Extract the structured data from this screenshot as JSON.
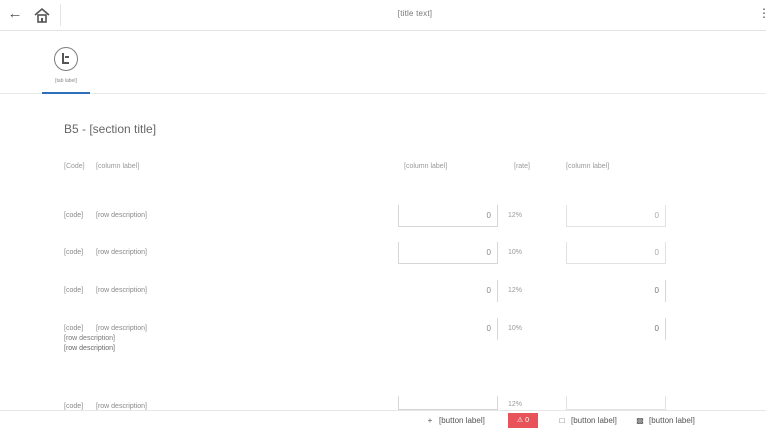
{
  "topbar": {
    "back_icon": "arrow-left-icon",
    "home_icon": "home-icon",
    "title": "[title text]",
    "more_icon": "more-vertical-icon"
  },
  "tab": {
    "label": "[tab label]",
    "icon": "document-icon"
  },
  "section": {
    "title": "B5 - [section title]"
  },
  "table": {
    "headers": {
      "code": "[Code]",
      "description": "[column label]",
      "amount": "[column label]",
      "rate": "[rate]",
      "result": "[column label]"
    },
    "rows": [
      {
        "code": "[code]",
        "description": "[row description]",
        "amount": "0",
        "rate": "12%",
        "result": "0"
      },
      {
        "code": "[code]",
        "description": "[row description]",
        "amount": "0",
        "rate": "10%",
        "result": "0"
      },
      {
        "code": "[code]",
        "description": "[row description]",
        "amount": "0",
        "rate": "12%",
        "result": "0"
      },
      {
        "code": "[code]",
        "description": "[row description]",
        "description_extra": "[row description]",
        "description_last": "[row description]",
        "amount": "0",
        "rate": "10%",
        "result": "0"
      },
      {
        "code": "[code]",
        "description": "[row description]",
        "amount": "",
        "rate": "12%",
        "result": ""
      }
    ]
  },
  "footer": {
    "add_label": "[button label]",
    "add_icon": "plus-icon",
    "error_count": "0",
    "error_icon": "alert-icon",
    "check_label": "[button label]",
    "check_icon": "check-document-icon",
    "save_label": "[button label]",
    "save_icon": "save-icon"
  },
  "colors": {
    "accent": "#2d6fb8",
    "error": "#e8535a"
  }
}
